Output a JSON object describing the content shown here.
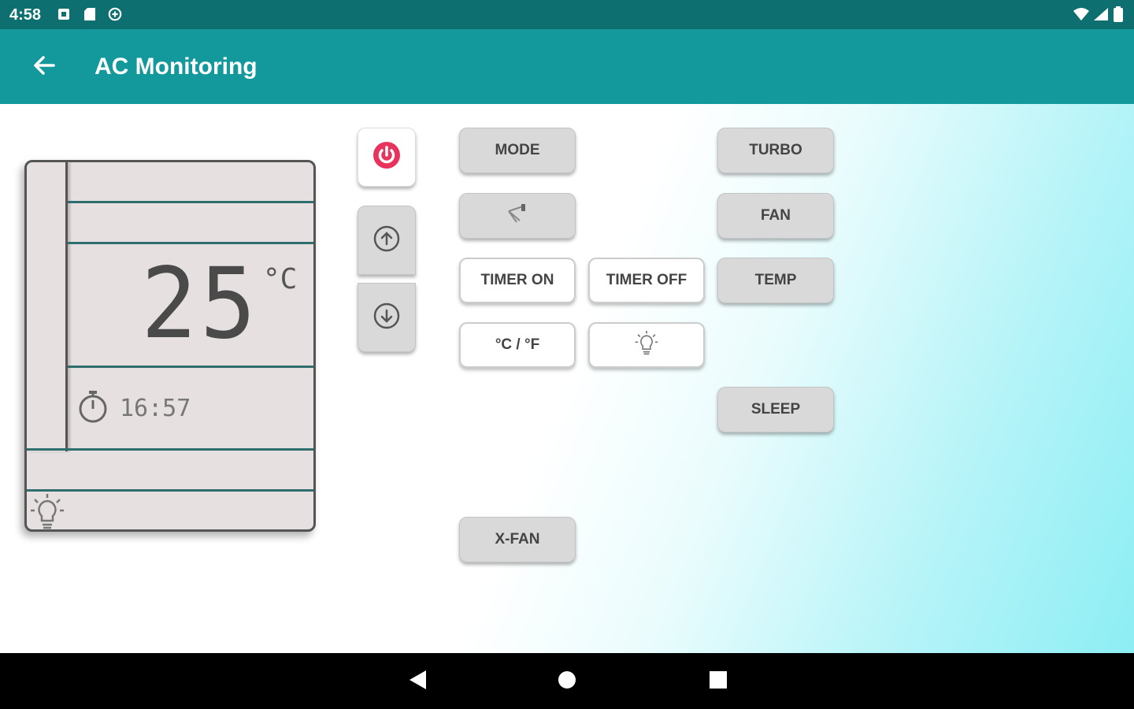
{
  "status_bar": {
    "time": "4:58",
    "icons": [
      "notification-icon",
      "sd-card-icon",
      "sync-icon",
      "wifi-icon",
      "signal-icon",
      "battery-icon"
    ]
  },
  "app_bar": {
    "title": "AC Monitoring",
    "back_icon": "arrow-left-icon",
    "color": "#13989c"
  },
  "display": {
    "temperature": "25",
    "unit": "°C",
    "timer": "16:57",
    "clock_icon": "stopwatch-icon",
    "light_icon": "bulb-icon"
  },
  "controls": {
    "power_icon": "power-icon",
    "power_color": "#e8335d",
    "up_icon": "arrow-up-circle-icon",
    "down_icon": "arrow-down-circle-icon",
    "mode": "MODE",
    "swing_icon": "swing-icon",
    "timer_on": "TIMER ON",
    "timer_off": "TIMER OFF",
    "unit_toggle": "°C / °F",
    "light_icon": "bulb-icon",
    "x_fan": "X-FAN",
    "turbo": "TURBO",
    "fan": "FAN",
    "temp": "TEMP",
    "sleep": "SLEEP"
  },
  "nav_bar": {
    "back_icon": "nav-back-icon",
    "home_icon": "nav-home-icon",
    "recents_icon": "nav-recents-icon"
  }
}
